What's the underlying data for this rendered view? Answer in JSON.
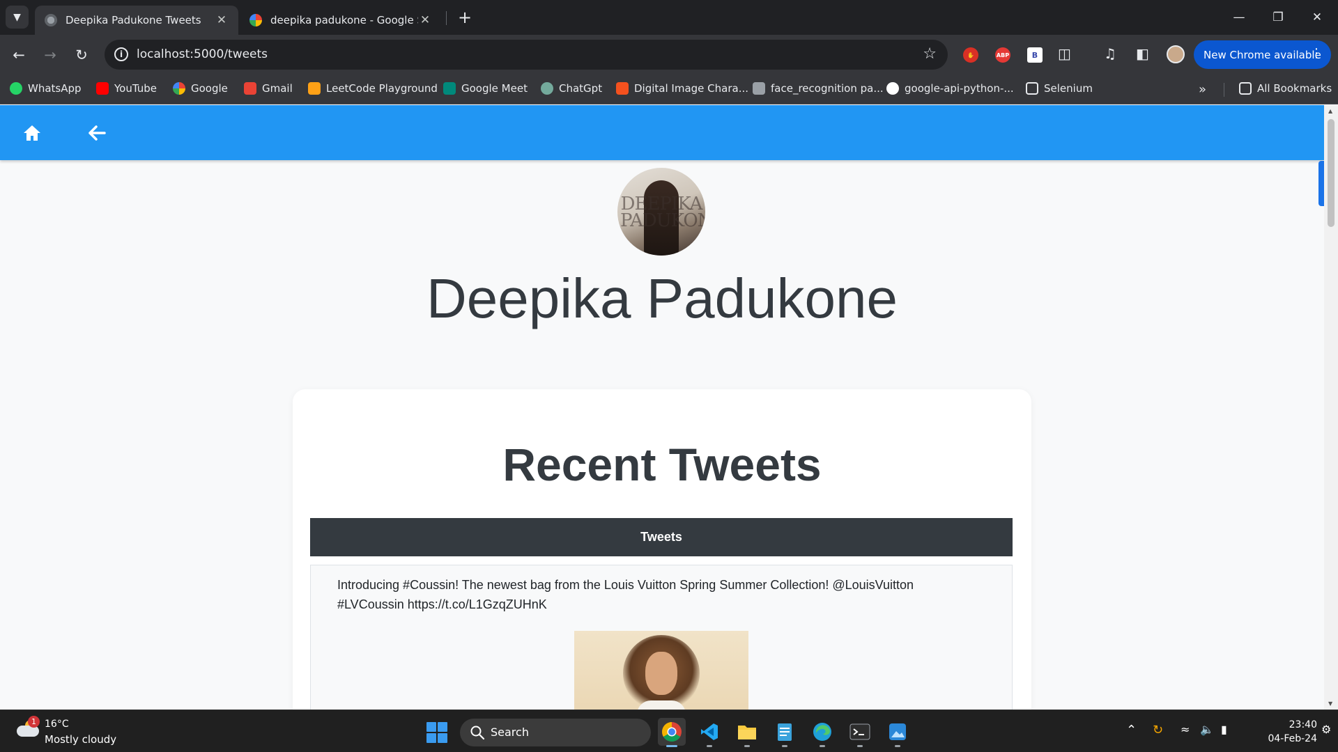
{
  "browser": {
    "tabs": [
      {
        "title": "Deepika Padukone Tweets",
        "active": true
      },
      {
        "title": "deepika padukone - Google Search",
        "active": false
      }
    ],
    "url": "localhost:5000/tweets",
    "update_button": "New Chrome available",
    "bookmarks": [
      {
        "label": "WhatsApp",
        "icon": "whatsapp-icon",
        "color": "#25d366"
      },
      {
        "label": "YouTube",
        "icon": "youtube-icon",
        "color": "#ff0000"
      },
      {
        "label": "Google",
        "icon": "google-icon",
        "color": "#4285f4"
      },
      {
        "label": "Gmail",
        "icon": "gmail-icon",
        "color": "#ea4335"
      },
      {
        "label": "LeetCode Playground",
        "icon": "leetcode-icon",
        "color": "#ffa116"
      },
      {
        "label": "Google Meet",
        "icon": "meet-icon",
        "color": "#00897b"
      },
      {
        "label": "ChatGpt",
        "icon": "chatgpt-icon",
        "color": "#74aa9c"
      },
      {
        "label": "Digital Image Chara...",
        "icon": "document-icon",
        "color": "#f4511e"
      },
      {
        "label": "face_recognition pa...",
        "icon": "book-icon",
        "color": "#9aa0a6"
      },
      {
        "label": "google-api-python-...",
        "icon": "github-icon",
        "color": "#ffffff"
      },
      {
        "label": "Selenium",
        "icon": "folder-icon",
        "color": "#e8eaed"
      }
    ],
    "all_bookmarks": "All Bookmarks"
  },
  "page": {
    "profile_name": "Deepika Padukone",
    "avatar_text": "DEEPIKA PADUKONE",
    "section_title": "Recent Tweets",
    "table_header": "Tweets",
    "tweets": [
      {
        "text": "Introducing #Coussin! The newest bag from the Louis Vuitton Spring Summer Collection! @LouisVuitton #LVCoussin https://t.co/L1GzqZUHnK"
      }
    ],
    "colors": {
      "appbar": "#2196f3",
      "table_header": "#343a40"
    }
  },
  "taskbar": {
    "weather_temp": "16°C",
    "weather_desc": "Mostly cloudy",
    "weather_badge": "1",
    "search_label": "Search",
    "time": "23:40",
    "date": "04-Feb-24"
  }
}
